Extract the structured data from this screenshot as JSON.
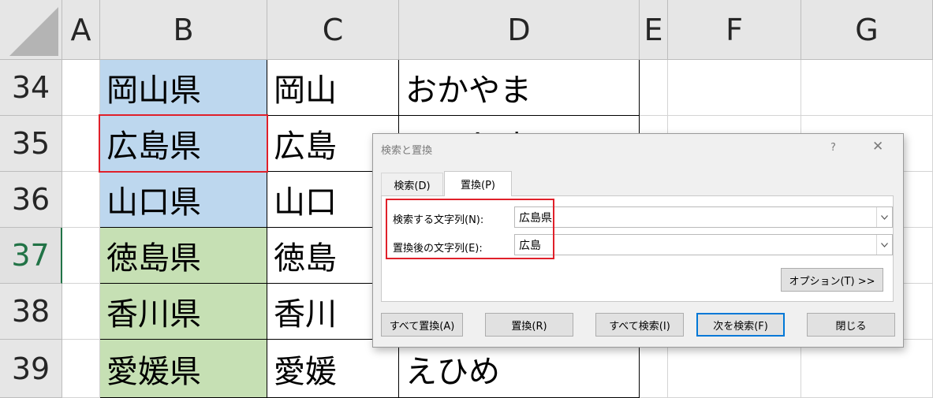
{
  "columns": [
    "A",
    "B",
    "C",
    "D",
    "E",
    "F",
    "G"
  ],
  "rows": [
    {
      "num": "34",
      "b": "岡山県",
      "c": "岡山",
      "d": "おかやま"
    },
    {
      "num": "35",
      "b": "広島県",
      "c": "広島",
      "d": "ひろしま"
    },
    {
      "num": "36",
      "b": "山口県",
      "c": "山口",
      "d": ""
    },
    {
      "num": "37",
      "b": "徳島県",
      "c": "徳島",
      "d": ""
    },
    {
      "num": "38",
      "b": "香川県",
      "c": "香川",
      "d": ""
    },
    {
      "num": "39",
      "b": "愛媛県",
      "c": "愛媛",
      "d": "えひめ"
    }
  ],
  "active_row": "37",
  "colors": {
    "fill_blue": "#bdd7ee",
    "fill_green": "#c6e0b4",
    "highlight_red": "#e0202a",
    "header_bg": "#e6e6e6",
    "active_header": "#217346"
  },
  "dialog": {
    "title": "検索と置換",
    "help": "?",
    "close": "✕",
    "tabs": [
      "検索(D)",
      "置換(P)"
    ],
    "active_tab": "置換(P)",
    "find_label": "検索する文字列(N):",
    "find_value": "広島県",
    "replace_label": "置換後の文字列(E):",
    "replace_value": "広島",
    "dropdown_icon": "chevron-down-icon",
    "options_button": "オプション(T) >>",
    "buttons": {
      "replace_all": "すべて置換(A)",
      "replace": "置換(R)",
      "find_all": "すべて検索(I)",
      "find_next": "次を検索(F)",
      "close": "閉じる"
    }
  }
}
